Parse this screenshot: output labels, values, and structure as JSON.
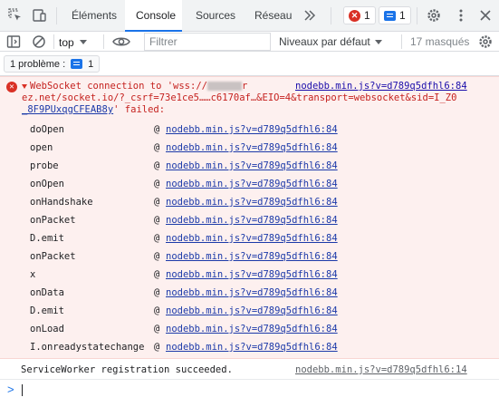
{
  "tabbar": {
    "tabs": [
      {
        "label": "Éléments",
        "active": false
      },
      {
        "label": "Console",
        "active": true
      },
      {
        "label": "Sources",
        "active": false
      },
      {
        "label": "Réseau",
        "active": false
      }
    ],
    "more_tabs_icon": "double-chevron-right-icon",
    "errors_count": "1",
    "messages_count": "1",
    "icons": [
      "inspect-element-icon",
      "device-toolbar-icon",
      "settings-gear-icon",
      "more-vertical-icon",
      "close-icon"
    ]
  },
  "toolbar": {
    "context": "top",
    "filter_placeholder": "Filtrer",
    "levels_label": "Niveaux par défaut",
    "hidden_count": "17 masqués",
    "icons": [
      "sidebar-toggle-icon",
      "clear-console-icon",
      "eye-icon",
      "console-settings-icon"
    ]
  },
  "issues": {
    "label": "1 problème :",
    "count": "1"
  },
  "error": {
    "line1_prefix": "WebSocket connection to 'wss://",
    "line1_suffix": "r",
    "source_link": "nodebb.min.js?v=d789q5dfhl6:84",
    "line2": "ez.net/socket.io/?_csrf=73e1ce5……c6170af…&EIO=4&transport=websocket&sid=I_Z0",
    "line3_link": "_8F9PUxqgCFEAB8y",
    "line3_suffix": "' failed:",
    "stack": [
      {
        "fn": "doOpen",
        "file": "nodebb.min.js?v=d789q5dfhl6:84"
      },
      {
        "fn": "open",
        "file": "nodebb.min.js?v=d789q5dfhl6:84"
      },
      {
        "fn": "probe",
        "file": "nodebb.min.js?v=d789q5dfhl6:84"
      },
      {
        "fn": "onOpen",
        "file": "nodebb.min.js?v=d789q5dfhl6:84"
      },
      {
        "fn": "onHandshake",
        "file": "nodebb.min.js?v=d789q5dfhl6:84"
      },
      {
        "fn": "onPacket",
        "file": "nodebb.min.js?v=d789q5dfhl6:84"
      },
      {
        "fn": "D.emit",
        "file": "nodebb.min.js?v=d789q5dfhl6:84"
      },
      {
        "fn": "onPacket",
        "file": "nodebb.min.js?v=d789q5dfhl6:84"
      },
      {
        "fn": "x",
        "file": "nodebb.min.js?v=d789q5dfhl6:84"
      },
      {
        "fn": "onData",
        "file": "nodebb.min.js?v=d789q5dfhl6:84"
      },
      {
        "fn": "D.emit",
        "file": "nodebb.min.js?v=d789q5dfhl6:84"
      },
      {
        "fn": "onLoad",
        "file": "nodebb.min.js?v=d789q5dfhl6:84"
      },
      {
        "fn": "I.onreadystatechange",
        "file": "nodebb.min.js?v=d789q5dfhl6:84"
      }
    ],
    "at": "@"
  },
  "info": {
    "message": "ServiceWorker registration succeeded.",
    "source": "nodebb.min.js?v=d789q5dfhl6:14"
  },
  "prompt": {
    "symbol": ">"
  }
}
